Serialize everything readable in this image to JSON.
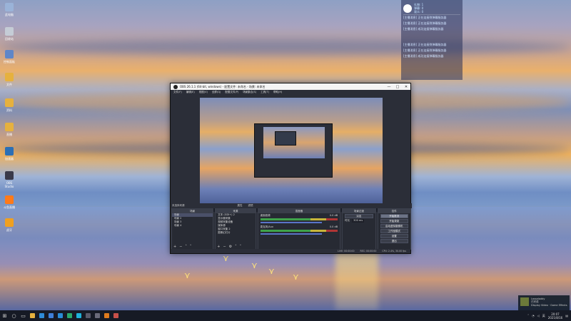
{
  "desktop_icons": [
    {
      "label": "此电脑",
      "color": "#9ab3d8"
    },
    {
      "label": "回收站",
      "color": "#c5ccd6"
    },
    {
      "label": "控制面板",
      "color": "#5f86c8"
    },
    {
      "label": "文件",
      "color": "#e6b13e"
    },
    {
      "label": "资料",
      "color": "#e6b13e"
    },
    {
      "label": "直播",
      "color": "#e6b13e"
    },
    {
      "label": "加速器",
      "color": "#2b6fb5"
    },
    {
      "label": "OBS Studio",
      "color": "#3a3a4a"
    },
    {
      "label": "斗鱼直播",
      "color": "#ff7a1a"
    },
    {
      "label": "虎牙",
      "color": "#f0a020"
    }
  ],
  "chat_overlay": {
    "stats": [
      "礼物: 1",
      "弹幕: 0",
      "观众: 0"
    ],
    "lines": [
      "[主播消息] 正在连接到弹幕服务器",
      "[主播消息] 正在连接到弹幕服务器",
      "[主播消息] 成功连接弹幕服务器",
      "[主播消息] 正在连接到弹幕服务器",
      "[主播消息] 正在连接到弹幕服务器",
      "[主播消息] 成功连接弹幕服务器"
    ]
  },
  "obs": {
    "title": "OBS 26.1.1 (64-bit, windows) - 配置文件: 未命名 - 场景: 未命名",
    "window_buttons": [
      "—",
      "□",
      "✕"
    ],
    "menu": [
      "文件(F)",
      "编辑(E)",
      "视图(V)",
      "全屏(Q)",
      "配置文件(P)",
      "场景集合(S)",
      "工具(T)",
      "帮助(H)"
    ],
    "status_label": "未选择来源",
    "status_buttons": [
      "属性",
      "滤镜"
    ],
    "scenes": {
      "title": "场景",
      "items": [
        "场景",
        "场景 2",
        "场景 3",
        "场景 4"
      ],
      "selected": 0
    },
    "sources": {
      "title": "来源",
      "items": [
        "文本 (GDI+) 2",
        "显示器采集",
        "视频采集设备",
        "媒体源",
        "窗口采集 2",
        "图像幻灯片"
      ]
    },
    "mixer": {
      "title": "混音器",
      "tracks": [
        {
          "name": "桌面音频",
          "db": "0.0 dB"
        },
        {
          "name": "麦克风/Aux",
          "db": "0.0 dB"
        }
      ]
    },
    "transitions": {
      "title": "场景过渡",
      "type": "淡出",
      "duration_label": "时长",
      "duration": "300 ms"
    },
    "controls": {
      "title": "控件",
      "buttons": [
        "开始推流",
        "开始录制",
        "启动虚拟摄像机",
        "工作室模式",
        "设置",
        "退出"
      ],
      "active": 0
    },
    "statusbar": [
      "LIVE: 00:00:00",
      "REC: 00:00:00",
      "CPU: 2.4%, 30.00 fps"
    ]
  },
  "notification": {
    "title": "Lossaladdy",
    "line1": "已完成",
    "line2": "Display Video · Game Effects"
  },
  "taskbar": {
    "apps": [
      {
        "name": "file-explorer",
        "color": "#e6b13e"
      },
      {
        "name": "edge",
        "color": "#2e8bd8"
      },
      {
        "name": "store",
        "color": "#3f7fd8"
      },
      {
        "name": "mail",
        "color": "#2a8bd6"
      },
      {
        "name": "browser",
        "color": "#2aa86b"
      },
      {
        "name": "chat",
        "color": "#1fb1d9"
      },
      {
        "name": "terminal",
        "color": "#5a5a6a"
      },
      {
        "name": "obs",
        "color": "#6a6a7a"
      },
      {
        "name": "media",
        "color": "#e07b1d"
      },
      {
        "name": "photos",
        "color": "#c8504a"
      }
    ],
    "tray": {
      "lang": "英",
      "time": "20:07",
      "date": "2021/8/16"
    }
  }
}
